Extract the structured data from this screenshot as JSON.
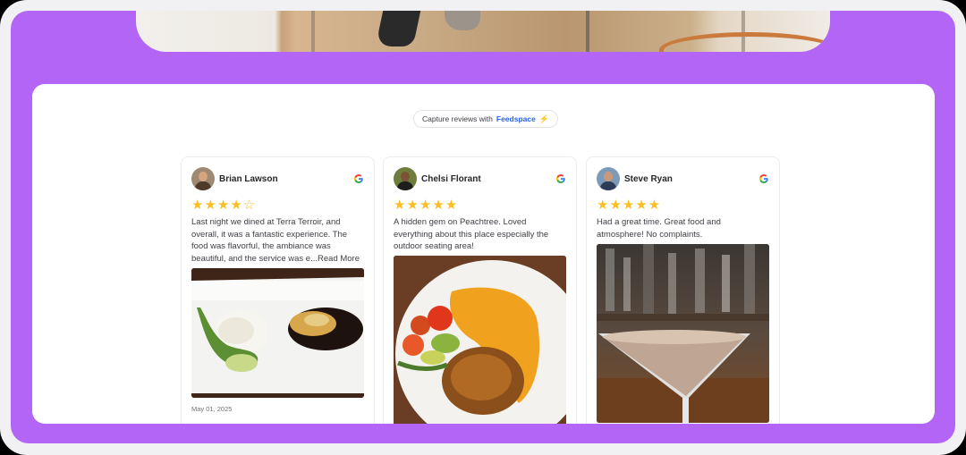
{
  "capture": {
    "prefix": "Capture reviews with",
    "brand": "Feedspace",
    "bolt": "⚡"
  },
  "reviews": [
    {
      "name": "Brian Lawson",
      "rating": 4,
      "stars_filled": "★★★★",
      "stars_empty": "☆",
      "text": "Last night we dined at Terra Terroir, and overall, it was a fantastic experience. The food was flavorful, the ambiance was beautiful, and the service was e",
      "more": "...Read More",
      "date": "May 01, 2025",
      "source_icon": "google-icon"
    },
    {
      "name": "Chelsi Florant",
      "rating": 5,
      "stars_filled": "★★★★★",
      "stars_empty": "",
      "text": "A hidden gem on Peachtree. Loved everything about this place especially the outdoor seating area!",
      "more": "",
      "date": "",
      "source_icon": "google-icon"
    },
    {
      "name": "Steve Ryan",
      "rating": 5,
      "stars_filled": "★★★★★",
      "stars_empty": "",
      "text": "Had a great time. Great food and atmosphere! No complaints.",
      "more": "",
      "date": "",
      "source_icon": "google-icon"
    }
  ],
  "colors": {
    "background": "#b366f5",
    "star": "#fbbf24",
    "brand": "#2563eb"
  }
}
